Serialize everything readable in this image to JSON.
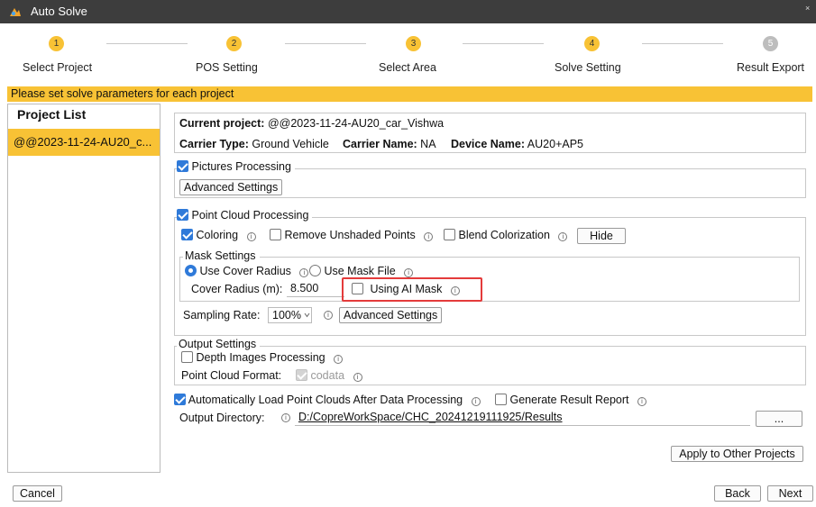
{
  "window": {
    "title": "Auto Solve",
    "close_label": "×"
  },
  "steps": [
    {
      "number": "1",
      "label": "Select Project",
      "state": "active"
    },
    {
      "number": "2",
      "label": "POS Setting",
      "state": "active"
    },
    {
      "number": "3",
      "label": "Select Area",
      "state": "active"
    },
    {
      "number": "4",
      "label": "Solve Setting",
      "state": "active"
    },
    {
      "number": "5",
      "label": "Result Export",
      "state": "inactive"
    }
  ],
  "banner": "Please set solve parameters for each project",
  "project_list": {
    "title": "Project List",
    "items": [
      "@@2023-11-24-AU20_c..."
    ]
  },
  "project_info": {
    "current_label": "Current project:",
    "current_value": "@@2023-11-24-AU20_car_Vishwa",
    "carrier_type_label": "Carrier Type:",
    "carrier_type_value": "Ground Vehicle",
    "carrier_name_label": "Carrier Name:",
    "carrier_name_value": "NA",
    "device_name_label": "Device Name:",
    "device_name_value": "AU20+AP5"
  },
  "pictures": {
    "label": "Pictures Processing",
    "checked": true,
    "advanced_label": "Advanced Settings"
  },
  "point_cloud": {
    "label": "Point Cloud Processing",
    "checked": true,
    "coloring_label": "Coloring",
    "remove_unshaded_label": "Remove Unshaded Points",
    "blend_label": "Blend Colorization",
    "hide_label": "Hide",
    "mask": {
      "title": "Mask Settings",
      "cover_radius_option": "Use Cover Radius",
      "mask_file_option": "Use Mask File",
      "cover_radius_label": "Cover Radius (m):",
      "cover_radius_value": "8.500",
      "ai_mask_label": "Using AI Mask"
    },
    "sampling_label": "Sampling Rate:",
    "sampling_value": "100%",
    "advanced_label": "Advanced Settings"
  },
  "output": {
    "title": "Output Settings",
    "depth_label": "Depth Images Processing",
    "format_label": "Point Cloud Format:",
    "format_value": "codata",
    "auto_load_label": "Automatically Load Point Clouds After Data Processing",
    "report_label": "Generate Result Report",
    "dir_label": "Output Directory:",
    "dir_value": "D:/CopreWorkSpace/CHC_20241219111925/Results",
    "browse_label": "..."
  },
  "buttons": {
    "apply": "Apply to Other Projects",
    "cancel": "Cancel",
    "back": "Back",
    "next": "Next"
  },
  "info_glyph": "i",
  "colors": {
    "accent": "#f8c235",
    "check": "#2f7ad9",
    "highlight": "#e43b3b",
    "titlebar": "#3d3d3d"
  }
}
